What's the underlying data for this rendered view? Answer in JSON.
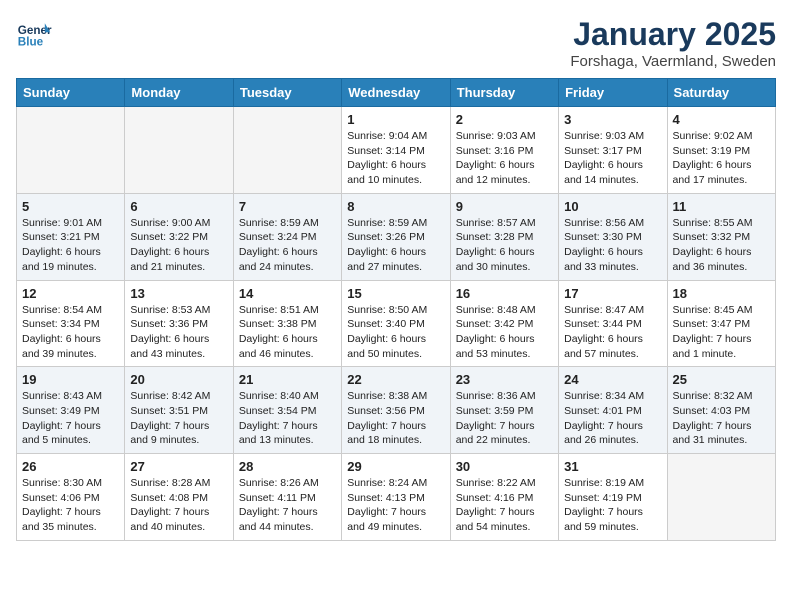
{
  "header": {
    "logo_line1": "General",
    "logo_line2": "Blue",
    "month": "January 2025",
    "location": "Forshaga, Vaermland, Sweden"
  },
  "weekdays": [
    "Sunday",
    "Monday",
    "Tuesday",
    "Wednesday",
    "Thursday",
    "Friday",
    "Saturday"
  ],
  "weeks": [
    [
      {
        "day": "",
        "info": ""
      },
      {
        "day": "",
        "info": ""
      },
      {
        "day": "",
        "info": ""
      },
      {
        "day": "1",
        "info": "Sunrise: 9:04 AM\nSunset: 3:14 PM\nDaylight: 6 hours\nand 10 minutes."
      },
      {
        "day": "2",
        "info": "Sunrise: 9:03 AM\nSunset: 3:16 PM\nDaylight: 6 hours\nand 12 minutes."
      },
      {
        "day": "3",
        "info": "Sunrise: 9:03 AM\nSunset: 3:17 PM\nDaylight: 6 hours\nand 14 minutes."
      },
      {
        "day": "4",
        "info": "Sunrise: 9:02 AM\nSunset: 3:19 PM\nDaylight: 6 hours\nand 17 minutes."
      }
    ],
    [
      {
        "day": "5",
        "info": "Sunrise: 9:01 AM\nSunset: 3:21 PM\nDaylight: 6 hours\nand 19 minutes."
      },
      {
        "day": "6",
        "info": "Sunrise: 9:00 AM\nSunset: 3:22 PM\nDaylight: 6 hours\nand 21 minutes."
      },
      {
        "day": "7",
        "info": "Sunrise: 8:59 AM\nSunset: 3:24 PM\nDaylight: 6 hours\nand 24 minutes."
      },
      {
        "day": "8",
        "info": "Sunrise: 8:59 AM\nSunset: 3:26 PM\nDaylight: 6 hours\nand 27 minutes."
      },
      {
        "day": "9",
        "info": "Sunrise: 8:57 AM\nSunset: 3:28 PM\nDaylight: 6 hours\nand 30 minutes."
      },
      {
        "day": "10",
        "info": "Sunrise: 8:56 AM\nSunset: 3:30 PM\nDaylight: 6 hours\nand 33 minutes."
      },
      {
        "day": "11",
        "info": "Sunrise: 8:55 AM\nSunset: 3:32 PM\nDaylight: 6 hours\nand 36 minutes."
      }
    ],
    [
      {
        "day": "12",
        "info": "Sunrise: 8:54 AM\nSunset: 3:34 PM\nDaylight: 6 hours\nand 39 minutes."
      },
      {
        "day": "13",
        "info": "Sunrise: 8:53 AM\nSunset: 3:36 PM\nDaylight: 6 hours\nand 43 minutes."
      },
      {
        "day": "14",
        "info": "Sunrise: 8:51 AM\nSunset: 3:38 PM\nDaylight: 6 hours\nand 46 minutes."
      },
      {
        "day": "15",
        "info": "Sunrise: 8:50 AM\nSunset: 3:40 PM\nDaylight: 6 hours\nand 50 minutes."
      },
      {
        "day": "16",
        "info": "Sunrise: 8:48 AM\nSunset: 3:42 PM\nDaylight: 6 hours\nand 53 minutes."
      },
      {
        "day": "17",
        "info": "Sunrise: 8:47 AM\nSunset: 3:44 PM\nDaylight: 6 hours\nand 57 minutes."
      },
      {
        "day": "18",
        "info": "Sunrise: 8:45 AM\nSunset: 3:47 PM\nDaylight: 7 hours\nand 1 minute."
      }
    ],
    [
      {
        "day": "19",
        "info": "Sunrise: 8:43 AM\nSunset: 3:49 PM\nDaylight: 7 hours\nand 5 minutes."
      },
      {
        "day": "20",
        "info": "Sunrise: 8:42 AM\nSunset: 3:51 PM\nDaylight: 7 hours\nand 9 minutes."
      },
      {
        "day": "21",
        "info": "Sunrise: 8:40 AM\nSunset: 3:54 PM\nDaylight: 7 hours\nand 13 minutes."
      },
      {
        "day": "22",
        "info": "Sunrise: 8:38 AM\nSunset: 3:56 PM\nDaylight: 7 hours\nand 18 minutes."
      },
      {
        "day": "23",
        "info": "Sunrise: 8:36 AM\nSunset: 3:59 PM\nDaylight: 7 hours\nand 22 minutes."
      },
      {
        "day": "24",
        "info": "Sunrise: 8:34 AM\nSunset: 4:01 PM\nDaylight: 7 hours\nand 26 minutes."
      },
      {
        "day": "25",
        "info": "Sunrise: 8:32 AM\nSunset: 4:03 PM\nDaylight: 7 hours\nand 31 minutes."
      }
    ],
    [
      {
        "day": "26",
        "info": "Sunrise: 8:30 AM\nSunset: 4:06 PM\nDaylight: 7 hours\nand 35 minutes."
      },
      {
        "day": "27",
        "info": "Sunrise: 8:28 AM\nSunset: 4:08 PM\nDaylight: 7 hours\nand 40 minutes."
      },
      {
        "day": "28",
        "info": "Sunrise: 8:26 AM\nSunset: 4:11 PM\nDaylight: 7 hours\nand 44 minutes."
      },
      {
        "day": "29",
        "info": "Sunrise: 8:24 AM\nSunset: 4:13 PM\nDaylight: 7 hours\nand 49 minutes."
      },
      {
        "day": "30",
        "info": "Sunrise: 8:22 AM\nSunset: 4:16 PM\nDaylight: 7 hours\nand 54 minutes."
      },
      {
        "day": "31",
        "info": "Sunrise: 8:19 AM\nSunset: 4:19 PM\nDaylight: 7 hours\nand 59 minutes."
      },
      {
        "day": "",
        "info": ""
      }
    ]
  ],
  "alt_rows": [
    1,
    3
  ]
}
